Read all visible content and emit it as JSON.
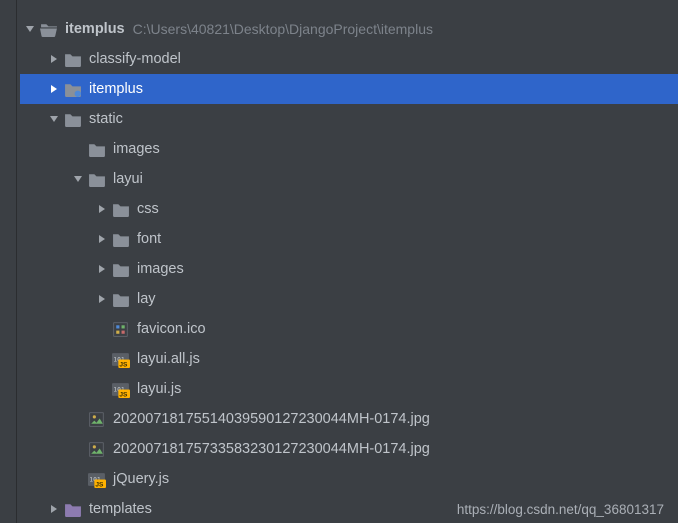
{
  "root": {
    "name": "itemplus",
    "path_hint": "C:\\Users\\40821\\Desktop\\DjangoProject\\itemplus"
  },
  "nodes": {
    "classify_model": "classify-model",
    "itemplus": "itemplus",
    "static": "static",
    "images": "images",
    "layui": "layui",
    "css": "css",
    "font": "font",
    "images2": "images",
    "lay": "lay",
    "favicon": "favicon.ico",
    "layui_all_js": "layui.all.js",
    "layui_js": "layui.js",
    "jpg1": "20200718175514039590127230044MH-0174.jpg",
    "jpg2": "20200718175733583230127230044MH-0174.jpg",
    "jquery": "jQuery.js",
    "templates": "templates"
  },
  "watermark": "https://blog.csdn.net/qq_36801317"
}
